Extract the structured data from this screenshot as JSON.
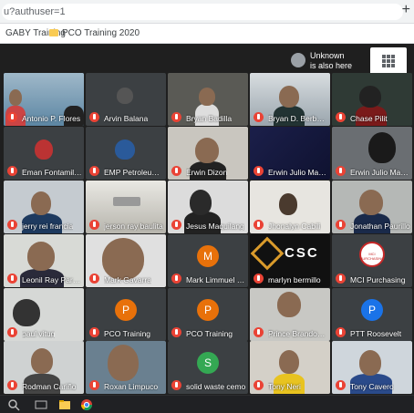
{
  "browser": {
    "url_text": "u?authuser=1",
    "new_tab": "+",
    "bookmarks": [
      {
        "label": "GABY Training"
      },
      {
        "label": "PCO Training 2020"
      }
    ]
  },
  "meet": {
    "unknown_line1": "Unknown",
    "unknown_line2": "is also here",
    "tiles": [
      {
        "name": "Antonio P. Flores"
      },
      {
        "name": "Arvin Balana"
      },
      {
        "name": "Bryan Badilla"
      },
      {
        "name": "Bryan D. Berbeco"
      },
      {
        "name": "Chase Pilit"
      },
      {
        "name": "Eman Fontamillas"
      },
      {
        "name": "EMP Petroleum O..."
      },
      {
        "name": "Erwin Dizon"
      },
      {
        "name": "Erwin Julio Maga..."
      },
      {
        "name": "Erwin Julio Maga..."
      },
      {
        "name": "jerry rei francia"
      },
      {
        "name": "jerson ray baulita"
      },
      {
        "name": "Jesus Maquilang"
      },
      {
        "name": "Jhonalyn Cabili"
      },
      {
        "name": "Jonathan Paurillo"
      },
      {
        "name": "Leonil Ray Pareja"
      },
      {
        "name": "Mark Gavarra"
      },
      {
        "name": "Mark Limmuel Fu...",
        "initial": "M",
        "color": "#e8710a"
      },
      {
        "name": "marlyn bermillo"
      },
      {
        "name": "MCI Purchasing"
      },
      {
        "name": "paul vitug"
      },
      {
        "name": "PCO Training",
        "initial": "P",
        "color": "#e8710a"
      },
      {
        "name": "PCO Training",
        "initial": "P",
        "color": "#e8710a"
      },
      {
        "name": "Prince Brandon I..."
      },
      {
        "name": "PTT Roosevelt",
        "initial": "P",
        "color": "#1a73e8"
      },
      {
        "name": "Rodman Cariño"
      },
      {
        "name": "Roxan Limpuco"
      },
      {
        "name": "solid waste cemo",
        "initial": "S",
        "color": "#34a853"
      },
      {
        "name": "Tony Neri"
      },
      {
        "name": "Tony Cavero"
      }
    ],
    "logo_text": "CSC",
    "mci_logo_text": "MCI PURCHASING"
  }
}
